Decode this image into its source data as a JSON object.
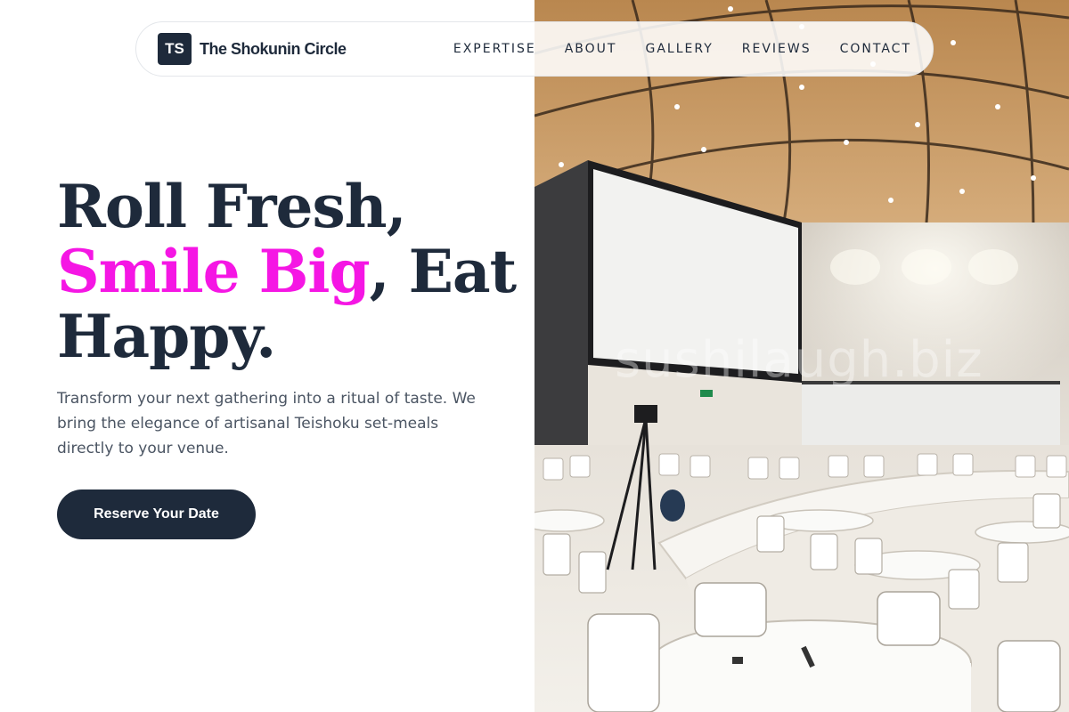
{
  "nav": {
    "logo_initials": "TS",
    "brand_name": "The Shokunin Circle",
    "links": [
      "EXPERTISE",
      "ABOUT",
      "GALLERY",
      "REVIEWS",
      "CONTACT"
    ]
  },
  "hero": {
    "headline_part1": "Roll Fresh,",
    "headline_accent": "Smile Big",
    "headline_part2": ", Eat",
    "headline_part3": "Happy.",
    "lede": "Transform your next gathering into a ritual of taste. We bring the elegance of artisanal Teishoku set-meals directly to your venue.",
    "cta_label": "Reserve Your Date"
  },
  "image": {
    "watermark": "sushilaugh.biz"
  },
  "colors": {
    "navy": "#1e2a3b",
    "accent_magenta": "#f516e4",
    "body_text": "#4b5563"
  }
}
